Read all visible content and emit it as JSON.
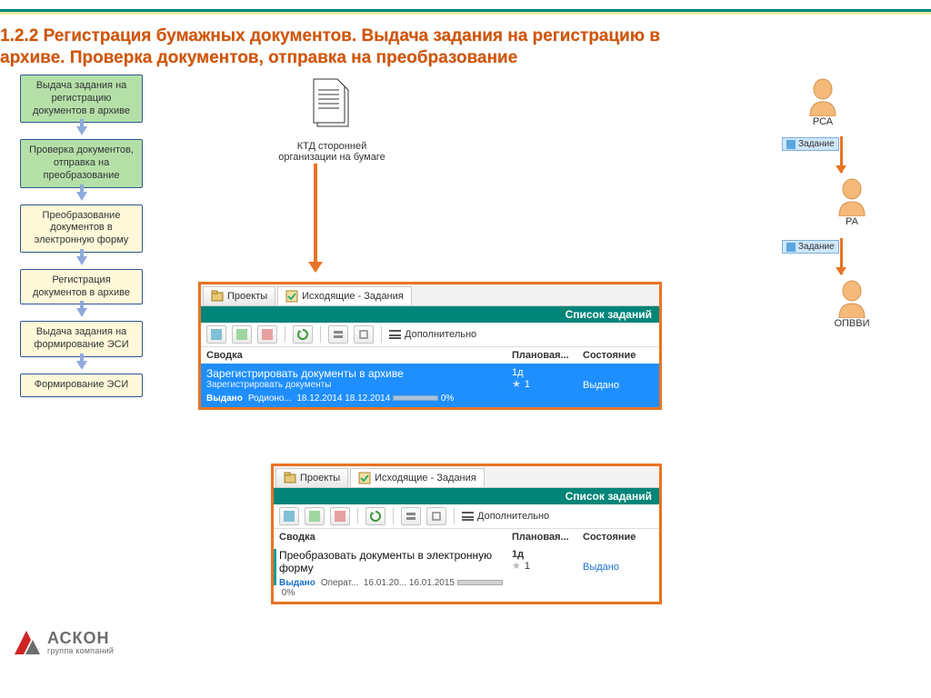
{
  "title_line1": "1.2.2 Регистрация бумажных документов. Выдача задания на регистрацию в",
  "title_line2": "архиве. Проверка документов, отправка на преобразование",
  "flow": {
    "steps": [
      "Выдача задания на регистрацию документов в архиве",
      "Проверка документов, отправка на преобразование",
      "Преобразование документов в электронную форму",
      "Регистрация документов в архиве",
      "Выдача задания на формирование ЭСИ",
      "Формирование ЭСИ"
    ]
  },
  "docs_caption": "КТД сторонней организации на бумаге",
  "panel_common": {
    "tab_projects": "Проекты",
    "tab_tasks": "Исходящие - Задания",
    "list_title": "Список заданий",
    "more_label": "Дополнительно",
    "col_summary": "Сводка",
    "col_planned": "Плановая...",
    "col_state": "Состояние"
  },
  "panel1": {
    "row_title": "Зарегистрировать документы в архиве",
    "row_sub": "Зарегистрировать документы",
    "row_status_label": "Выдано",
    "row_author": "Родионо...",
    "row_date1": "18.12.2014",
    "row_date2": "18.12.2014",
    "row_pct": "0%",
    "row_duration": "1д",
    "row_priority": "1",
    "row_state": "Выдано"
  },
  "panel2": {
    "row_title": "Преобразовать документы в электронную форму",
    "row_status_label": "Выдано",
    "row_author": "Операт...",
    "row_date1": "16.01.20...",
    "row_date2": "16.01.2015",
    "row_pct": "0%",
    "row_duration": "1д",
    "row_priority": "1",
    "row_state": "Выдано"
  },
  "actors": {
    "a1": "РСА",
    "a2": "РА",
    "a3": "ОПВВИ",
    "task_tag": "Задание"
  },
  "logo": {
    "name": "АСКОН",
    "sub": "группа компаний"
  }
}
